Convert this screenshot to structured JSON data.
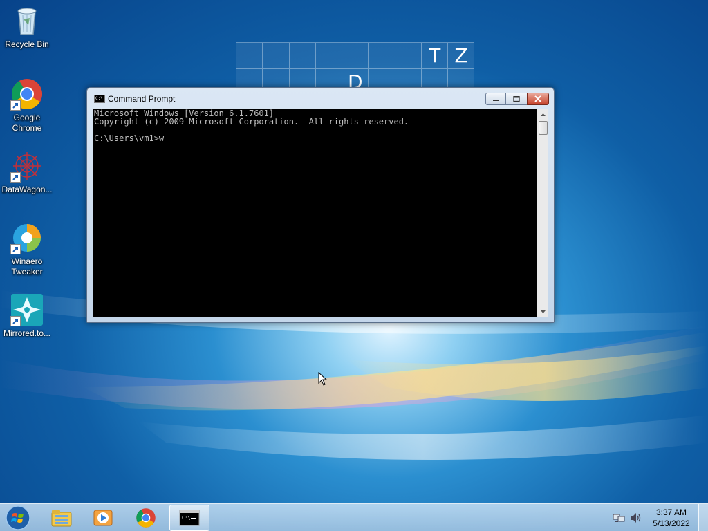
{
  "desktop": {
    "icons": [
      {
        "label": "Recycle Bin",
        "icon": "recycle-bin-icon"
      },
      {
        "label": "Google Chrome",
        "icon": "chrome-icon"
      },
      {
        "label": "DataWagon...",
        "icon": "datawagon-icon"
      },
      {
        "label": "Winaero Tweaker",
        "icon": "winaero-tweaker-icon"
      },
      {
        "label": "Mirrored.to...",
        "icon": "mirrored-to-icon"
      }
    ]
  },
  "crossword": {
    "row1": [
      "",
      "",
      "",
      "",
      "",
      "",
      "",
      "T",
      "Z"
    ],
    "row2": [
      "",
      "",
      "",
      "",
      "D",
      "",
      "",
      "",
      ""
    ]
  },
  "window": {
    "title": "Command Prompt",
    "console_lines": [
      "Microsoft Windows [Version 6.1.7601]",
      "Copyright (c) 2009 Microsoft Corporation.  All rights reserved.",
      "",
      "C:\\Users\\vm1>w"
    ]
  },
  "taskbar": {
    "pinned": [
      "windows-explorer-icon",
      "media-player-icon",
      "chrome-icon",
      "command-prompt-icon"
    ],
    "active": "command-prompt-icon",
    "clock_time": "3:37 AM",
    "clock_date": "5/13/2022"
  },
  "colors": {
    "console_bg": "#000000",
    "console_text": "#c0c0c0",
    "close_button": "#c7432b"
  }
}
